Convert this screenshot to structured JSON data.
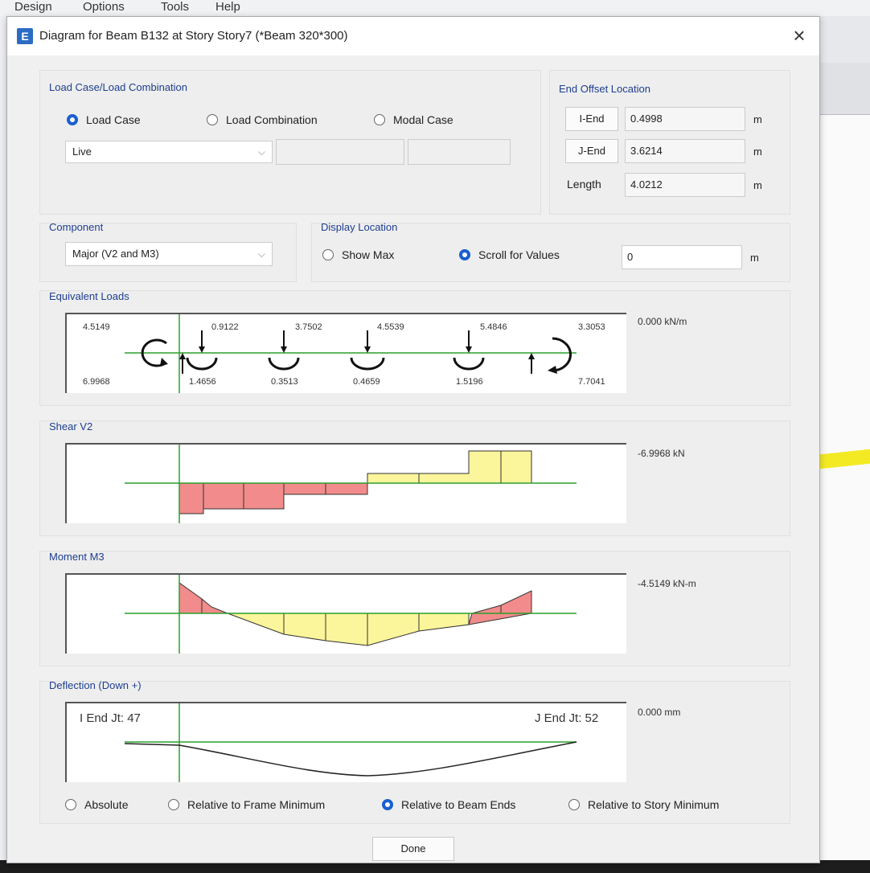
{
  "menu": [
    "Design",
    "Options",
    "Tools",
    "Help"
  ],
  "dialog": {
    "title": "Diagram for Beam B132 at Story Story7 (*Beam 320*300)",
    "logo": "E",
    "close": "×",
    "load_case_group": {
      "label": "Load Case/Load Combination",
      "options": [
        "Load Case",
        "Load Combination",
        "Modal Case"
      ],
      "selected": "Load Case",
      "case_value": "Live"
    },
    "end_offset": {
      "label": "End Offset Location",
      "rows": [
        {
          "button": "I-End",
          "value": "0.4998",
          "unit": "m"
        },
        {
          "button": "J-End",
          "value": "3.6214",
          "unit": "m"
        },
        {
          "label": "Length",
          "value": "4.0212",
          "unit": "m"
        }
      ]
    },
    "component": {
      "label": "Component",
      "value": "Major (V2 and M3)"
    },
    "display_location": {
      "label": "Display Location",
      "options": [
        "Show Max",
        "Scroll for Values"
      ],
      "selected": "Scroll for Values",
      "value": "0",
      "unit": "m"
    },
    "equivalent_loads": {
      "label": "Equivalent Loads",
      "top_values": [
        "4.5149",
        "0.9122",
        "3.7502",
        "4.5539",
        "5.4846",
        "3.3053"
      ],
      "bottom_values": [
        "6.9968",
        "1.4656",
        "0.3513",
        "0.4659",
        "1.5196",
        "7.7041"
      ],
      "readout": "0.000 kN/m"
    },
    "shear": {
      "label": "Shear V2",
      "readout": "-6.9968 kN"
    },
    "moment": {
      "label": "Moment M3",
      "readout": "-4.5149 kN-m"
    },
    "deflection": {
      "label": "Deflection (Down +)",
      "i_end": "I End Jt: 47",
      "j_end": "J End Jt: 52",
      "readout": "0.000 mm",
      "options": [
        "Absolute",
        "Relative to Frame Minimum",
        "Relative to Beam Ends",
        "Relative to Story Minimum"
      ],
      "selected": "Relative to Beam Ends"
    },
    "done": "Done"
  },
  "colors": {
    "negative_fill": "#f28b8b",
    "positive_fill": "#fbf59b",
    "baseline": "#2aa02a",
    "accent": "#1a5fd0"
  }
}
